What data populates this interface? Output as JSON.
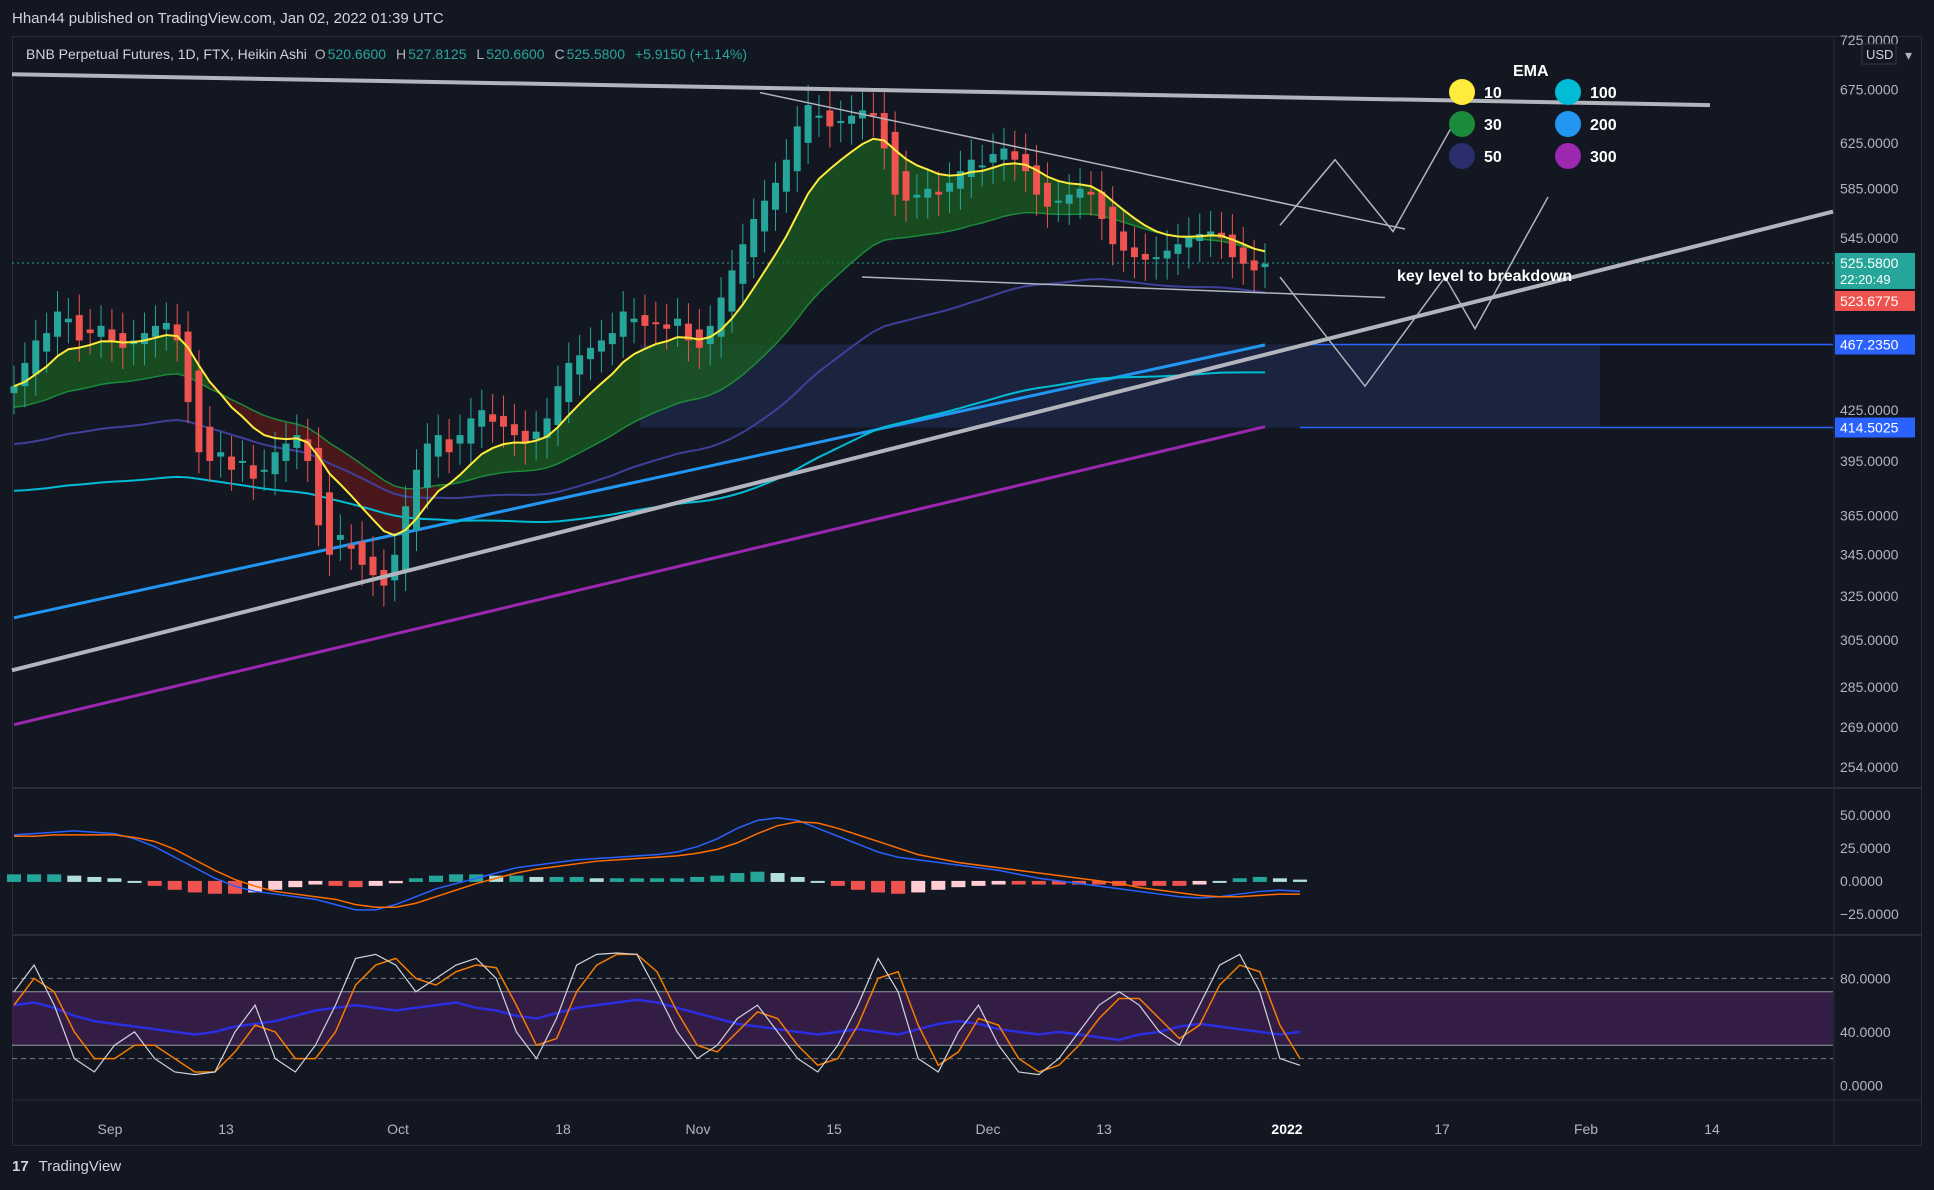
{
  "header": {
    "publisher_line": "Hhan44 published on TradingView.com, Jan 02, 2022 01:39 UTC"
  },
  "legend": {
    "symbol": "BNB Perpetual Futures, 1D, FTX, Heikin Ashi",
    "open_label": "O",
    "open": "520.6600",
    "high_label": "H",
    "high": "527.8125",
    "low_label": "L",
    "low": "520.6600",
    "close_label": "C",
    "close": "525.5800",
    "change": "+5.9150 (+1.14%)"
  },
  "currency_button": "USD",
  "footer": {
    "logo_text": "TradingView"
  },
  "colors": {
    "up": "#26a69a",
    "down": "#ef5350",
    "background": "#131722",
    "ema10": "#ffeb3b",
    "ema30": "#1b8a3a",
    "ema50": "#2a2e6a",
    "ema100": "#00bcd4",
    "ema200": "#2196f3",
    "ema300": "#9c27b0",
    "trendline": "#b2b5be",
    "zone": "#1e2a4a"
  },
  "chart_data": [
    {
      "type": "candlestick",
      "panel": "price",
      "style": "heikin-ashi",
      "y_axis": "log",
      "ylim": [
        250,
        725
      ],
      "x_ticks": [
        "Sep",
        "13",
        "Oct",
        "18",
        "Nov",
        "15",
        "Dec",
        "13",
        "2022",
        "17",
        "Feb",
        "14"
      ],
      "y_ticks": [
        "725.0000",
        "675.0000",
        "625.0000",
        "585.0000",
        "545.0000",
        "425.0000",
        "395.0000",
        "365.0000",
        "345.0000",
        "325.0000",
        "305.0000",
        "285.0000",
        "269.0000",
        "254.0000"
      ],
      "price_labels": [
        {
          "value": "525.5800",
          "sub": "22:20:49",
          "color": "#26a69a",
          "price": 525.58
        },
        {
          "value": "523.6775",
          "color": "#ef5350",
          "price": 523.68
        },
        {
          "value": "467.2350",
          "color": "#2962ff",
          "price": 467.235
        },
        {
          "value": "414.5025",
          "color": "#2962ff",
          "price": 414.5025
        }
      ],
      "closes": [
        440,
        455,
        470,
        475,
        490,
        485,
        470,
        475,
        480,
        470,
        465,
        470,
        475,
        480,
        482,
        470,
        430,
        400,
        395,
        400,
        390,
        395,
        385,
        390,
        400,
        405,
        410,
        395,
        360,
        345,
        355,
        348,
        340,
        335,
        330,
        345,
        370,
        390,
        405,
        410,
        400,
        410,
        420,
        425,
        418,
        415,
        410,
        405,
        412,
        420,
        440,
        455,
        460,
        465,
        470,
        475,
        490,
        485,
        480,
        482,
        478,
        485,
        470,
        465,
        480,
        500,
        520,
        540,
        560,
        575,
        590,
        610,
        640,
        660,
        650,
        640,
        645,
        650,
        655,
        650,
        620,
        580,
        575,
        580,
        585,
        580,
        590,
        600,
        610,
        605,
        615,
        620,
        610,
        600,
        580,
        570,
        575,
        580,
        585,
        580,
        560,
        540,
        535,
        530,
        528,
        530,
        535,
        540,
        545,
        548,
        550,
        545,
        530,
        525,
        520,
        525
      ],
      "ema": {
        "legend_title": "EMA",
        "items": [
          {
            "label": "10",
            "color": "#ffeb3b"
          },
          {
            "label": "30",
            "color": "#1b8a3a"
          },
          {
            "label": "50",
            "color": "#2a2e6a"
          },
          {
            "label": "100",
            "color": "#00bcd4"
          },
          {
            "label": "200",
            "color": "#2196f3"
          },
          {
            "label": "300",
            "color": "#9c27b0"
          }
        ]
      },
      "annotations": [
        {
          "text": "key level to breakdown"
        }
      ]
    },
    {
      "type": "bar",
      "panel": "macd",
      "y_ticks": [
        "50.0000",
        "25.0000",
        "0.0000",
        "−25.0000"
      ],
      "ylim": [
        -32,
        60
      ],
      "macd": [
        35,
        36,
        37,
        38,
        37,
        36,
        32,
        26,
        18,
        10,
        2,
        -4,
        -8,
        -10,
        -12,
        -14,
        -18,
        -22,
        -22,
        -18,
        -12,
        -6,
        -2,
        2,
        6,
        10,
        12,
        14,
        16,
        17,
        18,
        19,
        20,
        22,
        26,
        32,
        40,
        46,
        48,
        46,
        40,
        34,
        28,
        22,
        18,
        16,
        14,
        12,
        10,
        8,
        5,
        2,
        0,
        -2,
        -4,
        -6,
        -8,
        -10,
        -12,
        -13,
        -12,
        -10,
        -8,
        -7,
        -8
      ],
      "signal": [
        34,
        34,
        35,
        35,
        35,
        35,
        33,
        30,
        24,
        16,
        8,
        1,
        -4,
        -8,
        -10,
        -12,
        -14,
        -18,
        -20,
        -20,
        -17,
        -12,
        -7,
        -2,
        2,
        6,
        9,
        11,
        13,
        15,
        16,
        17,
        18,
        19,
        21,
        24,
        29,
        36,
        42,
        45,
        44,
        40,
        35,
        30,
        25,
        20,
        17,
        14,
        12,
        10,
        8,
        6,
        4,
        2,
        0,
        -2,
        -5,
        -7,
        -9,
        -11,
        -12,
        -12,
        -11,
        -10,
        -10
      ],
      "histogram": [
        5,
        5,
        5,
        4,
        3,
        2,
        0,
        -3,
        -6,
        -8,
        -9,
        -9,
        -8,
        -6,
        -4,
        -2,
        -3,
        -4,
        -3,
        -1,
        2,
        4,
        5,
        5,
        4,
        4,
        3,
        3,
        3,
        2,
        2,
        2,
        2,
        2,
        3,
        4,
        6,
        7,
        6,
        3,
        0,
        -3,
        -6,
        -8,
        -9,
        -8,
        -6,
        -4,
        -3,
        -2,
        -2,
        -2,
        -2,
        -2,
        -2,
        -3,
        -3,
        -3,
        -3,
        -2,
        0,
        2,
        3,
        2,
        1
      ]
    },
    {
      "type": "line",
      "panel": "stoch_rsi",
      "y_ticks": [
        "80.0000",
        "40.0000",
        "0.0000"
      ],
      "ylim": [
        -5,
        105
      ],
      "band": [
        30,
        70
      ],
      "rsi": [
        60,
        62,
        58,
        52,
        48,
        46,
        44,
        42,
        40,
        38,
        40,
        44,
        46,
        48,
        52,
        56,
        58,
        60,
        58,
        56,
        58,
        60,
        62,
        58,
        56,
        52,
        50,
        54,
        58,
        60,
        62,
        64,
        62,
        58,
        54,
        50,
        46,
        44,
        42,
        40,
        38,
        40,
        42,
        40,
        38,
        42,
        46,
        48,
        46,
        42,
        40,
        38,
        40,
        38,
        36,
        34,
        38,
        40,
        44,
        46,
        44,
        42,
        40,
        38,
        40
      ],
      "k": [
        70,
        90,
        60,
        20,
        10,
        30,
        40,
        20,
        10,
        8,
        10,
        40,
        60,
        20,
        10,
        30,
        60,
        95,
        98,
        90,
        70,
        80,
        90,
        95,
        80,
        40,
        20,
        50,
        90,
        98,
        99,
        98,
        70,
        40,
        20,
        30,
        50,
        60,
        40,
        20,
        10,
        30,
        60,
        95,
        70,
        20,
        10,
        40,
        60,
        30,
        10,
        8,
        20,
        40,
        60,
        70,
        60,
        40,
        30,
        60,
        90,
        98,
        70,
        20,
        15
      ],
      "d": [
        60,
        80,
        70,
        40,
        20,
        20,
        30,
        30,
        20,
        10,
        10,
        25,
        45,
        40,
        20,
        20,
        40,
        75,
        90,
        95,
        80,
        75,
        85,
        90,
        88,
        60,
        30,
        35,
        70,
        90,
        98,
        98,
        85,
        55,
        30,
        25,
        40,
        55,
        50,
        30,
        15,
        20,
        45,
        80,
        85,
        45,
        15,
        25,
        50,
        45,
        20,
        10,
        15,
        30,
        50,
        65,
        65,
        50,
        35,
        45,
        75,
        90,
        85,
        45,
        20
      ]
    }
  ]
}
